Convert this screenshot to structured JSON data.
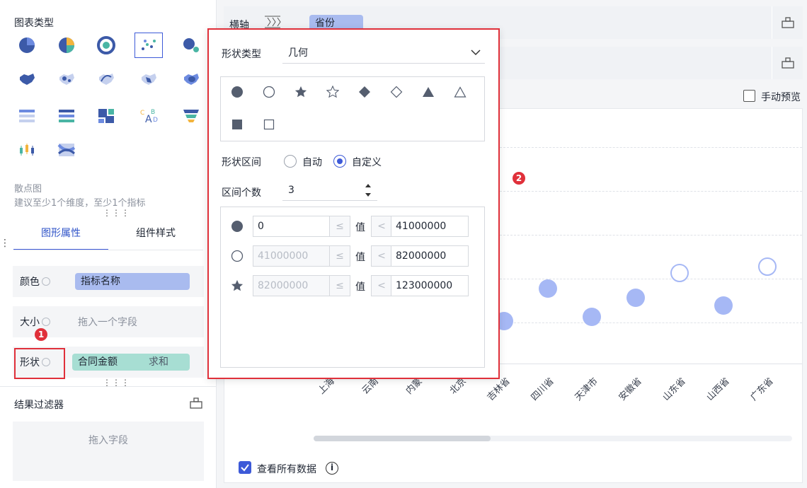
{
  "left": {
    "chart_type_title": "图表类型",
    "chart_types": [
      "pie",
      "donut",
      "ring",
      "scatter",
      "bubble",
      "china-map",
      "dot-map",
      "flow-map",
      "region-map",
      "heat-map",
      "rank-list",
      "bar-list",
      "treemap",
      "word-cloud",
      "funnel",
      "k-line",
      "sankey"
    ],
    "selected_chart_name": "散点图",
    "selected_chart_hint": "建议至少1个维度，至少1个指标",
    "tabs": [
      "图形属性",
      "组件样式"
    ],
    "props": {
      "color_label": "颜色",
      "color_field": "指标名称",
      "size_label": "大小",
      "size_placeholder": "拖入一个字段",
      "shape_label": "形状",
      "shape_field": "合同金额",
      "shape_agg": "求和"
    },
    "filter_title": "结果过滤器",
    "filter_placeholder": "拖入字段"
  },
  "axis": {
    "x_label": "横轴",
    "x_field": "省份"
  },
  "manual_preview": "手动预览",
  "view_all": "查看所有数据",
  "chart_data": {
    "type": "scatter",
    "categories": [
      "上海市",
      "云南省",
      "内蒙古",
      "北京市",
      "吉林省",
      "四川省",
      "天津市",
      "安徽省",
      "山东省",
      "山西省",
      "广东省"
    ],
    "visible_x_labels": [
      "上海",
      "云南",
      "内蒙",
      "北京",
      "吉林省",
      "四川省",
      "天津市",
      "安徽省",
      "山东省",
      "山西省",
      "广东省"
    ],
    "points": [
      {
        "cat": "吉林省",
        "shape": "filled-circle"
      },
      {
        "cat": "四川省",
        "shape": "filled-circle"
      },
      {
        "cat": "天津市",
        "shape": "filled-circle"
      },
      {
        "cat": "安徽省",
        "shape": "filled-circle"
      },
      {
        "cat": "山东省",
        "shape": "hollow-circle"
      },
      {
        "cat": "山西省",
        "shape": "filled-circle"
      },
      {
        "cat": "广东省",
        "shape": "hollow-circle"
      }
    ],
    "point_color": "#a6b8f5"
  },
  "popup": {
    "shape_type_label": "形状类型",
    "shape_type_value": "几何",
    "shape_icons": [
      "filled-circle",
      "hollow-circle",
      "filled-star",
      "hollow-star",
      "filled-diamond",
      "hollow-diamond",
      "filled-triangle",
      "hollow-triangle",
      "filled-square",
      "hollow-square"
    ],
    "range_label": "形状区间",
    "range_auto": "自动",
    "range_custom": "自定义",
    "count_label": "区间个数",
    "count_value": "3",
    "ranges": [
      {
        "icon": "filled-circle",
        "from": "0",
        "from_disabled": false,
        "cmp1": "≤",
        "mid": "值",
        "cmp2": "<",
        "to": "41000000"
      },
      {
        "icon": "hollow-circle",
        "from": "41000000",
        "from_disabled": true,
        "cmp1": "≤",
        "mid": "值",
        "cmp2": "<",
        "to": "82000000"
      },
      {
        "icon": "filled-star",
        "from": "82000000",
        "from_disabled": true,
        "cmp1": "≤",
        "mid": "值",
        "cmp2": "<",
        "to": "123000000"
      }
    ]
  },
  "badges": [
    "1",
    "2"
  ],
  "colors": {
    "accent": "#3d5ad8",
    "highlight": "#e0303a",
    "field_blue": "#a9bbef",
    "field_teal": "#a7ded3"
  }
}
